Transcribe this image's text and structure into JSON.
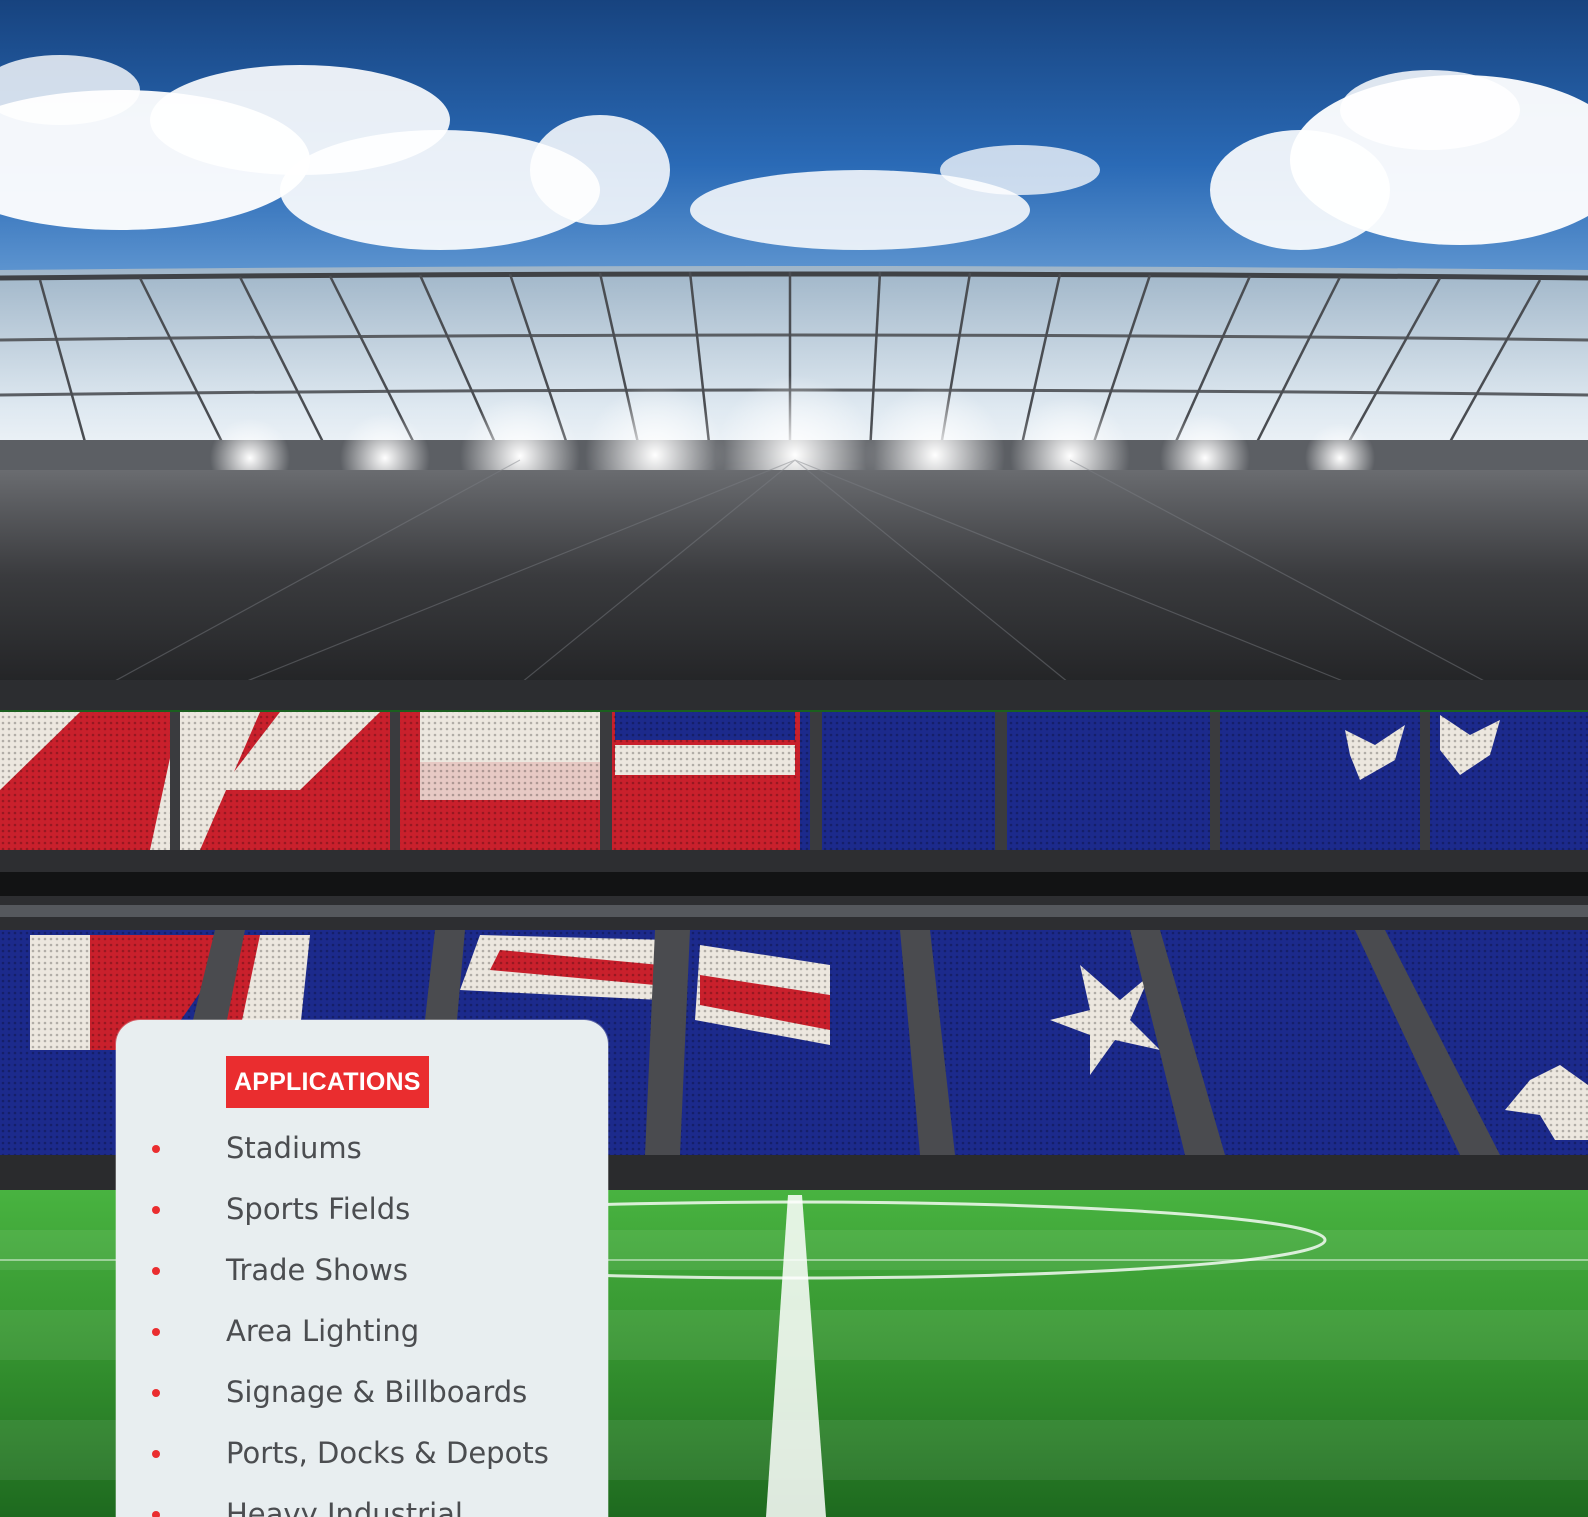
{
  "colors": {
    "sky": "#2a6ab6",
    "turf": "#3ea23b",
    "flag_red": "#c9202c",
    "flag_blue": "#1c2a8c",
    "flag_white": "#ece7df",
    "card": "#e8eef0",
    "accent": "#ea2d2f",
    "text": "#4b4d50"
  },
  "applications": {
    "heading": "APPLICATIONS",
    "items": [
      "Stadiums",
      "Sports Fields",
      "Trade Shows",
      "Area Lighting",
      "Signage & Billboards",
      "Ports, Docks & Depots",
      "Heavy Industrial"
    ]
  }
}
